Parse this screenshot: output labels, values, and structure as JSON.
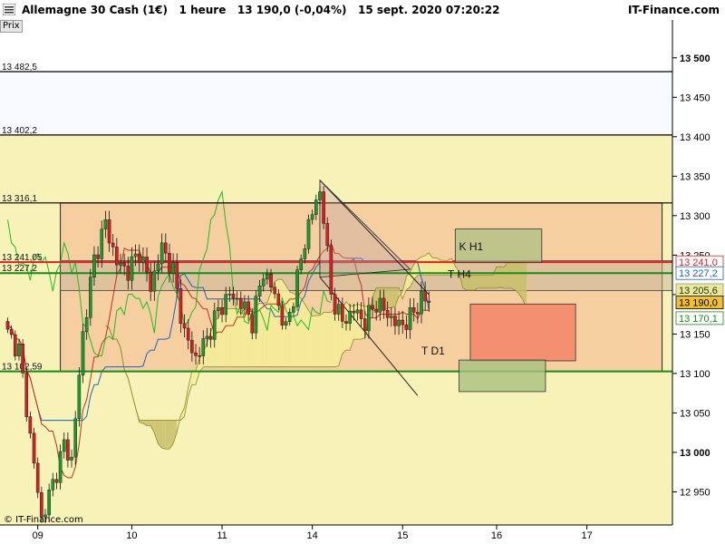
{
  "header": {
    "title": "Allemagne 30 Cash (1€)   1 heure   13 190,0 (-0,04%)   15 sept. 2020 07:20:22",
    "brand": "IT-Finance.com",
    "tab_label": "Prix",
    "copyright": "© IT-Finance.com"
  },
  "chart_data": {
    "type": "candlestick",
    "ylim": [
      12908,
      13548
    ],
    "y_ticks": [
      {
        "value": 13500,
        "label": "13 500"
      },
      {
        "value": 13450,
        "label": "13 450"
      },
      {
        "value": 13400,
        "label": "13 400"
      },
      {
        "value": 13350,
        "label": "13 350"
      },
      {
        "value": 13300,
        "label": "13 300"
      },
      {
        "value": 13250,
        "label": "13 250"
      },
      {
        "value": 13200,
        "label": "13 200"
      },
      {
        "value": 13150,
        "label": "13 150"
      },
      {
        "value": 13100,
        "label": "13 100"
      },
      {
        "value": 13050,
        "label": "13 050"
      },
      {
        "value": 13000,
        "label": "13 000"
      },
      {
        "value": 12950,
        "label": "12 950"
      }
    ],
    "x_ticks": [
      {
        "bar": 8,
        "label": "09"
      },
      {
        "bar": 33,
        "label": "10"
      },
      {
        "bar": 57,
        "label": "11"
      },
      {
        "bar": 81,
        "label": "14"
      },
      {
        "bar": 105,
        "label": "15"
      },
      {
        "bar": 130,
        "label": "16"
      },
      {
        "bar": 154,
        "label": "17"
      }
    ],
    "levels": [
      {
        "value": 13482.5,
        "label": "13 482,5",
        "color": "#000000"
      },
      {
        "value": 13402.2,
        "label": "13 402,2",
        "color": "#000000"
      },
      {
        "value": 13316.1,
        "label": "13 316,1",
        "color": "#000000"
      },
      {
        "value": 13241.05,
        "label": "13 241,05",
        "color": "#e02020"
      },
      {
        "value": 13227.2,
        "label": "13 227,2",
        "color": "#1a8a1a"
      },
      {
        "value": 13102.59,
        "label": "13 102,59",
        "color": "#1a8a1a"
      }
    ],
    "price_tags": [
      {
        "value": 13241.0,
        "label": "13 241,0",
        "bg": "#ffffff",
        "fg": "#e02020",
        "border": "#e02020"
      },
      {
        "value": 13227.2,
        "label": "13 227,2",
        "bg": "#ffffff",
        "fg": "#2060c0",
        "border": "#2060c0"
      },
      {
        "value": 13205.6,
        "label": "13 205,6",
        "bg": "#e8e8a0",
        "fg": "#333300",
        "border": "#999966"
      },
      {
        "value": 13190.0,
        "label": "13 190,0",
        "bg": "#f0c030",
        "fg": "#000000",
        "border": "#000000"
      },
      {
        "value": 13170.1,
        "label": "13 170,1",
        "bg": "#ffffff",
        "fg": "#1a8a1a",
        "border": "#1a8a1a"
      }
    ],
    "zone_labels": [
      "K H1",
      "T H4",
      "T D1"
    ],
    "colors": {
      "bull": "#1f9a2a",
      "bear": "#d42020",
      "tenkan": "#c03020",
      "kijun": "#2060c0",
      "chikou": "#22bb22",
      "cloud_bull": "#f5ef99",
      "cloud_bear": "#c8bf6a",
      "orange_zone": "#f5cfa0",
      "yellow_band": "#f7f2b8"
    },
    "anchors": [
      [
        0,
        13150
      ],
      [
        3,
        13130
      ],
      [
        6,
        13020
      ],
      [
        9,
        12915
      ],
      [
        12,
        12960
      ],
      [
        15,
        13010
      ],
      [
        17,
        12990
      ],
      [
        20,
        13150
      ],
      [
        23,
        13245
      ],
      [
        26,
        13290
      ],
      [
        29,
        13240
      ],
      [
        32,
        13230
      ],
      [
        35,
        13255
      ],
      [
        38,
        13210
      ],
      [
        41,
        13260
      ],
      [
        44,
        13230
      ],
      [
        47,
        13150
      ],
      [
        50,
        13120
      ],
      [
        53,
        13145
      ],
      [
        56,
        13180
      ],
      [
        59,
        13200
      ],
      [
        62,
        13190
      ],
      [
        65,
        13165
      ],
      [
        68,
        13230
      ],
      [
        71,
        13200
      ],
      [
        74,
        13155
      ],
      [
        77,
        13220
      ],
      [
        80,
        13290
      ],
      [
        83,
        13330
      ],
      [
        84,
        13300
      ],
      [
        86,
        13200
      ],
      [
        89,
        13165
      ],
      [
        92,
        13180
      ],
      [
        95,
        13165
      ],
      [
        98,
        13190
      ],
      [
        101,
        13175
      ],
      [
        104,
        13160
      ],
      [
        107,
        13170
      ],
      [
        110,
        13195
      ],
      [
        112,
        13190
      ]
    ],
    "last_bar": 112,
    "future_bars": 130
  }
}
